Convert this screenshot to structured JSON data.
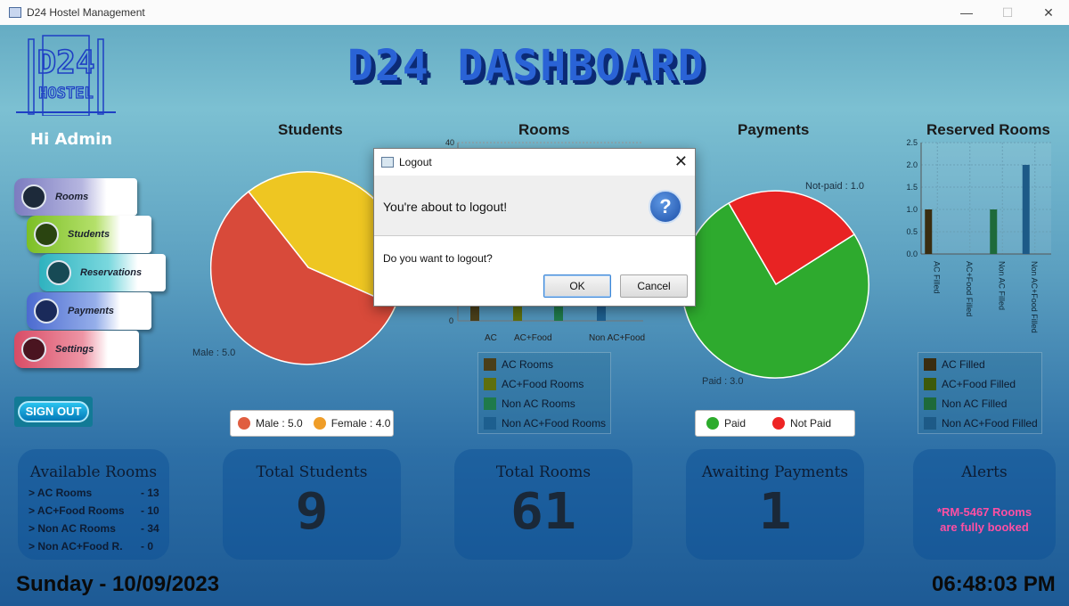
{
  "window": {
    "title": "D24 Hostel Management",
    "controls": [
      "minimize-icon",
      "maximize-icon",
      "close-icon"
    ]
  },
  "header": {
    "greeting": "Hi Admin",
    "dashboard_title": "D24 DASHBOARD",
    "logo_text": [
      "D24",
      "HOSTEL"
    ]
  },
  "nav": {
    "items": [
      {
        "label": "Rooms",
        "icon": "home-icon",
        "color": "#8f8fc8"
      },
      {
        "label": "Students",
        "icon": "students-icon",
        "color": "#96cc3a"
      },
      {
        "label": "Reservations",
        "icon": "reservations-icon",
        "color": "#39bfc8"
      },
      {
        "label": "Payments",
        "icon": "payments-icon",
        "color": "#5f7dd8"
      },
      {
        "label": "Settings",
        "icon": "gear-icon",
        "color": "#e0607a"
      }
    ],
    "sign_out": "SIGN OUT"
  },
  "charts": {
    "students": {
      "title": "Students",
      "male_label": "Male : 5.0",
      "legend": [
        {
          "label": "Male : 5.0",
          "color": "#e05e40"
        },
        {
          "label": "Female : 4.0",
          "color": "#ef9d28"
        }
      ]
    },
    "rooms": {
      "title": "Rooms",
      "y_top": "40",
      "y_zero": "0",
      "x_labels": [
        "AC",
        "AC+Food",
        "Non AC+Food"
      ],
      "legend": [
        {
          "label": "AC Rooms",
          "color": "#4a3f1a"
        },
        {
          "label": "AC+Food Rooms",
          "color": "#5e6f0e"
        },
        {
          "label": "Non AC Rooms",
          "color": "#1f7a4a"
        },
        {
          "label": "Non AC+Food Rooms",
          "color": "#1d5f8f"
        }
      ]
    },
    "payments": {
      "title": "Payments",
      "notpaid_label": "Not-paid : 1.0",
      "paid_label": "Paid : 3.0",
      "legend": [
        {
          "label": "Paid",
          "color": "#2cab2c"
        },
        {
          "label": "Not Paid",
          "color": "#ee2424"
        }
      ]
    },
    "reserved": {
      "title": "Reserved Rooms",
      "legend": [
        {
          "label": "AC Filled",
          "color": "#3a2d10"
        },
        {
          "label": "AC+Food Filled",
          "color": "#3d5a0a"
        },
        {
          "label": "Non AC Filled",
          "color": "#1e6a3a"
        },
        {
          "label": "Non AC+Food Filled",
          "color": "#1d5a87"
        }
      ]
    }
  },
  "chart_data": [
    {
      "type": "pie",
      "title": "Students",
      "categories": [
        "Male",
        "Female"
      ],
      "values": [
        5.0,
        4.0
      ],
      "colors": [
        "#e05e40",
        "#ef9d28"
      ]
    },
    {
      "type": "bar",
      "title": "Rooms",
      "categories": [
        "AC",
        "AC+Food",
        "Non AC",
        "Non AC+Food"
      ],
      "values": [
        13,
        10,
        34,
        4
      ],
      "ylim": [
        0,
        40
      ]
    },
    {
      "type": "pie",
      "title": "Payments",
      "categories": [
        "Paid",
        "Not-paid"
      ],
      "values": [
        3.0,
        1.0
      ],
      "colors": [
        "#2cab2c",
        "#ee2424"
      ]
    },
    {
      "type": "bar",
      "title": "Reserved Rooms",
      "categories": [
        "AC Filled",
        "AC+Food Filled",
        "Non AC Filled",
        "Non AC+Food Filled"
      ],
      "values": [
        1.0,
        0.0,
        1.0,
        2.0
      ],
      "ylim": [
        0,
        2.5
      ],
      "yticks": [
        "2.5",
        "2.0",
        "1.5",
        "1.0",
        "0.5",
        "0.0"
      ]
    }
  ],
  "cards": {
    "available": {
      "title": "Available Rooms",
      "rows": [
        {
          "label": "> AC Rooms",
          "value": "- 13"
        },
        {
          "label": "> AC+Food Rooms",
          "value": "- 10"
        },
        {
          "label": "> Non AC Rooms",
          "value": "- 34"
        },
        {
          "label": "> Non AC+Food R.",
          "value": "- 0"
        }
      ]
    },
    "total_students": {
      "title": "Total Students",
      "value": "9"
    },
    "total_rooms": {
      "title": "Total Rooms",
      "value": "61"
    },
    "awaiting": {
      "title": "Awaiting Payments",
      "value": "1"
    },
    "alerts": {
      "title": "Alerts",
      "line1": "*RM-5467 Rooms",
      "line2": "are fully booked"
    }
  },
  "footer": {
    "date": "Sunday - 10/09/2023",
    "time": "06:48:03 PM"
  },
  "dialog": {
    "title": "Logout",
    "header": "You're about to logout!",
    "body": "Do you want to logout?",
    "ok": "OK",
    "cancel": "Cancel",
    "icon": "question-icon"
  }
}
